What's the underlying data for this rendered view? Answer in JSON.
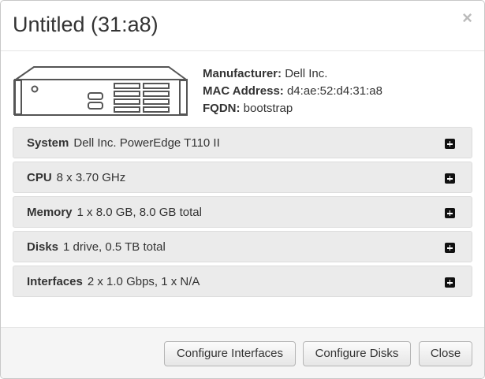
{
  "dialog": {
    "title": "Untitled (31:a8)",
    "close_glyph": "×"
  },
  "summary": {
    "manufacturer_label": "Manufacturer:",
    "manufacturer_value": "Dell Inc.",
    "mac_label": "MAC Address:",
    "mac_value": "d4:ae:52:d4:31:a8",
    "fqdn_label": "FQDN:",
    "fqdn_value": "bootstrap"
  },
  "sections": [
    {
      "label": "System",
      "value": "Dell Inc. PowerEdge T110 II",
      "icon": "plus-square-icon"
    },
    {
      "label": "CPU",
      "value": "8 x 3.70 GHz",
      "icon": "plus-square-icon"
    },
    {
      "label": "Memory",
      "value": "1 x 8.0 GB, 8.0 GB total",
      "icon": "plus-square-icon"
    },
    {
      "label": "Disks",
      "value": "1 drive, 0.5 TB total",
      "icon": "plus-square-icon"
    },
    {
      "label": "Interfaces",
      "value": "2 x 1.0 Gbps, 1 x N/A",
      "icon": "plus-square-icon"
    }
  ],
  "footer": {
    "configure_interfaces": "Configure Interfaces",
    "configure_disks": "Configure Disks",
    "close": "Close"
  },
  "colors": {
    "panel_bg": "#ebebeb",
    "footer_bg": "#f5f5f5",
    "text": "#333333"
  }
}
